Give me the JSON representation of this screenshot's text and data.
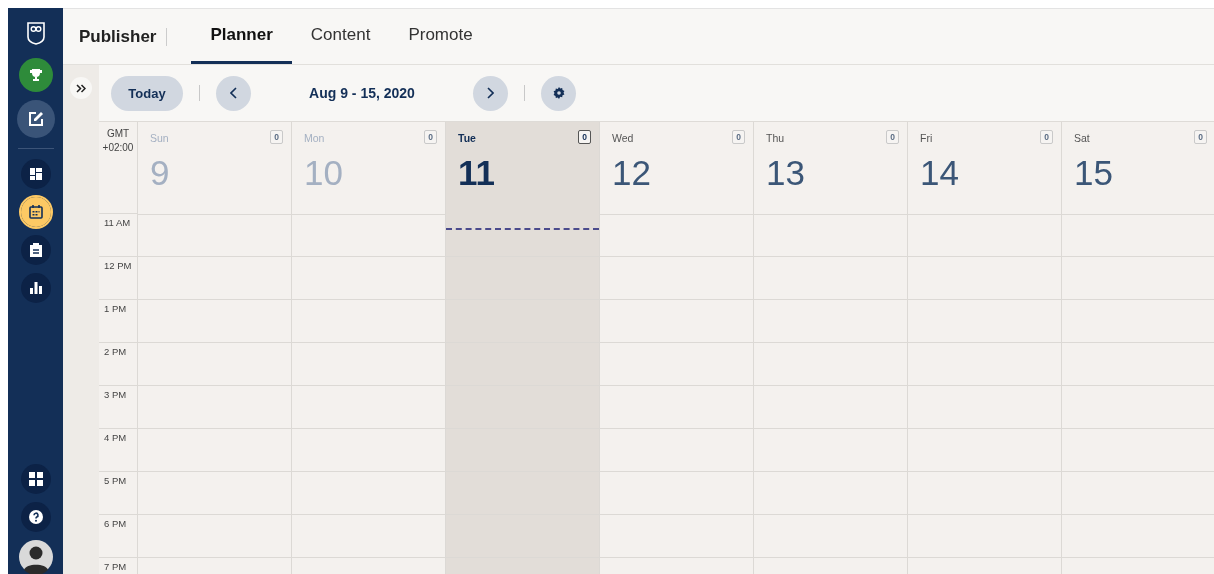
{
  "sidebar": {
    "items": [
      {
        "kind": "logo",
        "selected": false
      },
      {
        "kind": "trophy",
        "selected": false
      },
      {
        "kind": "compose",
        "selected": false
      },
      {
        "kind": "dashboard",
        "selected": false
      },
      {
        "kind": "calendar",
        "selected": true
      },
      {
        "kind": "clipboard",
        "selected": false
      },
      {
        "kind": "analytics",
        "selected": false
      },
      {
        "kind": "apps",
        "selected": false
      },
      {
        "kind": "help",
        "selected": false
      },
      {
        "kind": "avatar",
        "selected": false
      }
    ]
  },
  "header": {
    "title": "Publisher",
    "tabs": [
      {
        "label": "Planner",
        "selected": true
      },
      {
        "label": "Content",
        "selected": false
      },
      {
        "label": "Promote",
        "selected": false
      }
    ]
  },
  "toolbar": {
    "today_button": "Today",
    "date_range": "Aug 9 - 15, 2020"
  },
  "calendar": {
    "timezone": [
      "GMT",
      "+02:00"
    ],
    "days": [
      {
        "name": "Sun",
        "date": "9",
        "count": "0",
        "past": true,
        "selected": false
      },
      {
        "name": "Mon",
        "date": "10",
        "count": "0",
        "past": true,
        "selected": false
      },
      {
        "name": "Tue",
        "date": "11",
        "count": "0",
        "past": false,
        "selected": true
      },
      {
        "name": "Wed",
        "date": "12",
        "count": "0",
        "past": false,
        "selected": false
      },
      {
        "name": "Thu",
        "date": "13",
        "count": "0",
        "past": false,
        "selected": false
      },
      {
        "name": "Fri",
        "date": "14",
        "count": "0",
        "past": false,
        "selected": false
      },
      {
        "name": "Sat",
        "date": "15",
        "count": "0",
        "past": false,
        "selected": false
      }
    ],
    "hours": [
      "11 AM",
      "12 PM",
      "1 PM",
      "2 PM",
      "3 PM",
      "4 PM",
      "5 PM",
      "6 PM",
      "7 PM"
    ]
  }
}
